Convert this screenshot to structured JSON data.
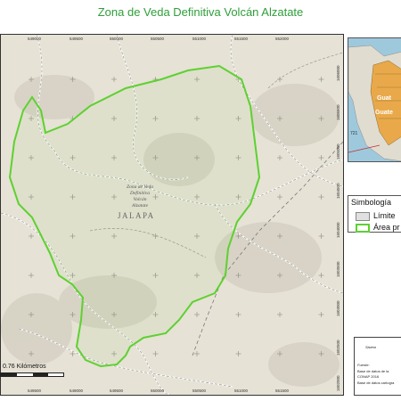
{
  "title": "Zona de Veda Definitiva Volcán Alzatate",
  "map": {
    "x_ticks": [
      "549000",
      "549500",
      "550000",
      "550500",
      "551000",
      "551500",
      "552000"
    ],
    "x_ticks_bottom": [
      "549500",
      "549000",
      "549500",
      "550000",
      "550500",
      "551000",
      "551500"
    ],
    "y_ticks": [
      "1606000",
      "1605500",
      "1605000",
      "1604500",
      "1604000",
      "1603500",
      "1603000",
      "1602500",
      "1602000"
    ],
    "zone_label": [
      "Zona de Veda",
      "Definitiva",
      "Volcán",
      "Alzatate"
    ],
    "place_label": "JALAPA",
    "scale_label": "0.76 Kilómetros",
    "area_color": "#5ed130",
    "terrain_color": "#e6e2d6"
  },
  "inset": {
    "labels": [
      "Guat",
      "Guate"
    ],
    "coast_label": "721"
  },
  "legend": {
    "title": "Simbología",
    "items": [
      {
        "label": "Límite",
        "color": "#e0e0e0"
      },
      {
        "label": "Área pr",
        "color": "#5ed130"
      }
    ]
  },
  "info": {
    "heading": "Sistem",
    "fuente": "Fuente:",
    "line1": "Base de datos de la",
    "line2": "CONAP 2016",
    "line3": "Base de datos cartogra"
  }
}
